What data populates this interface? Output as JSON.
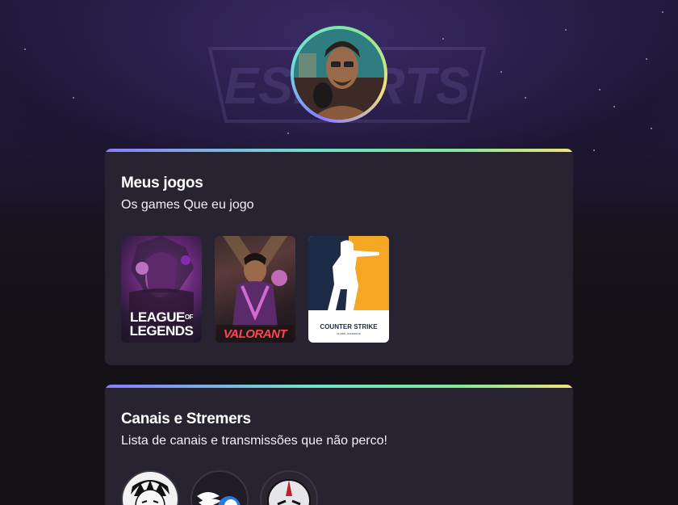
{
  "profile": {
    "avatar_alt": "profile-photo"
  },
  "games_section": {
    "title": "Meus jogos",
    "subtitle": "Os games Que eu jogo",
    "games": [
      {
        "name": "League of Legends",
        "logo_line1": "LEAGUE",
        "logo_of": "OF",
        "logo_line2": "LEGENDS"
      },
      {
        "name": "Valorant",
        "logo": "VALORANT"
      },
      {
        "name": "Counter-Strike",
        "logo_line1": "COUNTER",
        "logo_line2": "STRIKE",
        "logo_small": "GLOBAL OFFENSIVE"
      }
    ]
  },
  "channels_section": {
    "title": "Canais e Stremers",
    "subtitle": "Lista de canais e transmissões que não perco!"
  },
  "colors": {
    "card_bg": "#272331",
    "accent_gradient": [
      "#8a7bff",
      "#6ee6c8",
      "#7fe89a",
      "#f2e27a"
    ],
    "page_bg": "#141217"
  }
}
